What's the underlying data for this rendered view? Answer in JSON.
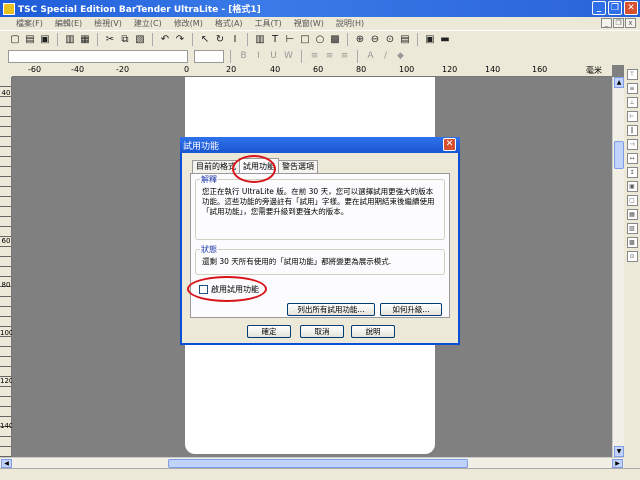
{
  "window": {
    "title": "TSC Special Edition BarTender UltraLite - [格式1]"
  },
  "menu": [
    "檔案(F)",
    "編輯(E)",
    "檢視(V)",
    "建立(C)",
    "修改(M)",
    "格式(A)",
    "工具(T)",
    "視窗(W)",
    "說明(H)"
  ],
  "ruler": {
    "labels": [
      "-60",
      "-40",
      "-20",
      "0",
      "20",
      "40",
      "60",
      "80",
      "100",
      "120",
      "140",
      "160"
    ],
    "unit": "毫米"
  },
  "vruler": {
    "labels": [
      "40",
      "60",
      "80",
      "100",
      "120",
      "140"
    ]
  },
  "dialog": {
    "title": "試用功能",
    "tabs": [
      "目前的格式",
      "試用功能",
      "警告選項"
    ],
    "active_tab": "試用功能",
    "explain_title": "解釋",
    "explain_text": "您正在執行 UltraLite 版。在前 30 天，您可以選擇試用更強大的版本功能。這些功能的旁邊註有「試用」字樣。要在試用期結束後繼續使用「試用功能」，您需要升級到更強大的版本。",
    "status_title": "狀態",
    "status_text": "還剩 30 天所有使用的「試用功能」都將變更為展示模式.",
    "enable_label": "啟用試用功能",
    "list_button": "列出所有試用功能...",
    "upgrade_button": "如何升級...",
    "ok": "確定",
    "cancel": "取消",
    "help": "說明"
  }
}
